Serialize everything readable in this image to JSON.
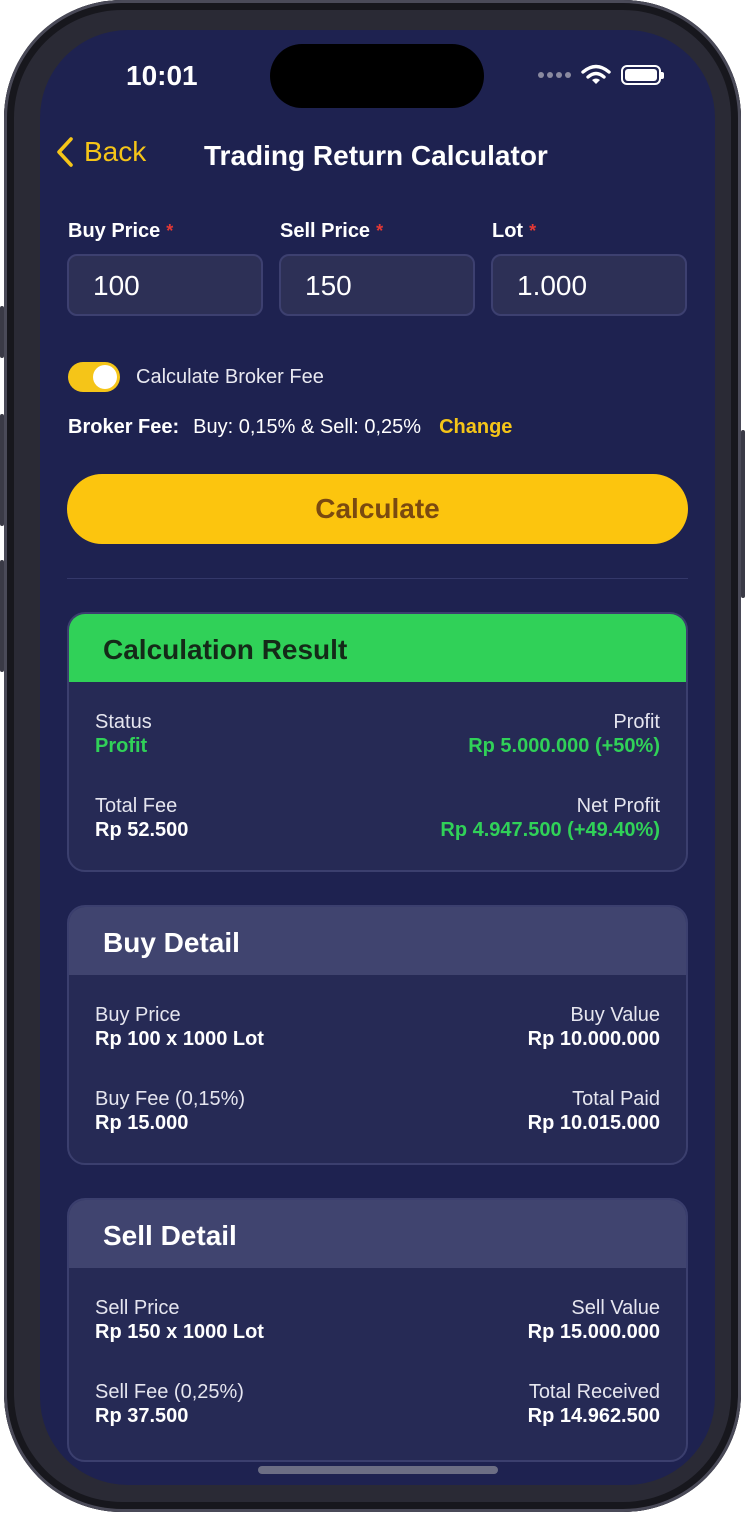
{
  "status_bar": {
    "time": "10:01"
  },
  "nav": {
    "back_label": "Back",
    "title": "Trading Return Calculator"
  },
  "form": {
    "buy_price": {
      "label": "Buy Price",
      "value": "100"
    },
    "sell_price": {
      "label": "Sell Price",
      "value": "150"
    },
    "lot": {
      "label": "Lot",
      "value": "1.000"
    },
    "required_mark": "*"
  },
  "broker": {
    "toggle_label": "Calculate Broker Fee",
    "toggle_on": true,
    "fee_label": "Broker Fee:",
    "fee_value": "Buy: 0,15% & Sell: 0,25%",
    "change_label": "Change"
  },
  "calculate_label": "Calculate",
  "result": {
    "title": "Calculation Result",
    "status_label": "Status",
    "status_value": "Profit",
    "profit_label": "Profit",
    "profit_value": "Rp 5.000.000 (+50%)",
    "total_fee_label": "Total Fee",
    "total_fee_value": "Rp 52.500",
    "net_profit_label": "Net Profit",
    "net_profit_value": "Rp 4.947.500 (+49.40%)"
  },
  "buy_detail": {
    "title": "Buy Detail",
    "price_label": "Buy Price",
    "price_value": "Rp 100 x 1000 Lot",
    "value_label": "Buy Value",
    "value_value": "Rp 10.000.000",
    "fee_label": "Buy Fee (0,15%)",
    "fee_value": "Rp 15.000",
    "total_label": "Total Paid",
    "total_value": "Rp 10.015.000"
  },
  "sell_detail": {
    "title": "Sell Detail",
    "price_label": "Sell Price",
    "price_value": "Rp 150 x 1000 Lot",
    "value_label": "Sell Value",
    "value_value": "Rp 15.000.000",
    "fee_label": "Sell Fee (0,25%)",
    "fee_value": "Rp 37.500",
    "total_label": "Total Received",
    "total_value": "Rp 14.962.500"
  },
  "colors": {
    "background": "#1e2250",
    "accent": "#fcc50e",
    "profit_green": "#30d158",
    "required_red": "#e53935"
  }
}
